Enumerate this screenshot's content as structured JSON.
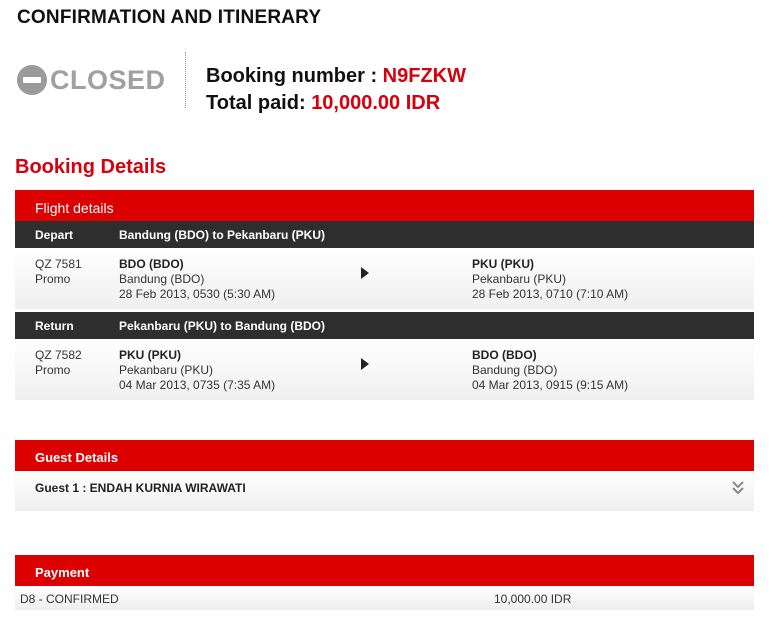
{
  "page": {
    "title": "CONFIRMATION AND ITINERARY"
  },
  "status": {
    "label": "CLOSED",
    "icon": "minus-circle-icon"
  },
  "summary": {
    "booking_label": "Booking number : ",
    "booking_number": "N9FZKW",
    "total_label": "Total paid: ",
    "total_value": "10,000.00 IDR"
  },
  "booking_details": {
    "heading": "Booking Details",
    "panel_title": "Flight details",
    "segments": [
      {
        "direction": "Depart",
        "route": "Bandung (BDO) to Pekanbaru (PKU)",
        "flight_no": "QZ 7581",
        "fare": "Promo",
        "from_code": "BDO (BDO)",
        "from_city": "Bandung (BDO)",
        "from_time": "28 Feb 2013, 0530 (5:30 AM)",
        "to_code": "PKU (PKU)",
        "to_city": "Pekanbaru (PKU)",
        "to_time": "28 Feb 2013, 0710 (7:10 AM)"
      },
      {
        "direction": "Return",
        "route": "Pekanbaru (PKU) to Bandung (BDO)",
        "flight_no": "QZ 7582",
        "fare": "Promo",
        "from_code": "PKU (PKU)",
        "from_city": "Pekanbaru (PKU)",
        "from_time": "04 Mar 2013, 0735 (7:35 AM)",
        "to_code": "BDO (BDO)",
        "to_city": "Bandung (BDO)",
        "to_time": "04 Mar 2013, 0915 (9:15 AM)"
      }
    ]
  },
  "guest_details": {
    "title": "Guest Details",
    "guests": [
      "Guest 1 : ENDAH KURNIA WIRAWATI"
    ],
    "expand_icon": "double-chevron-down-icon"
  },
  "payment": {
    "title": "Payment",
    "rows": [
      {
        "label": "D8 - CONFIRMED",
        "amount": "10,000.00 IDR"
      }
    ]
  },
  "colors": {
    "accent_red": "#dd0000",
    "dark_bar": "#2e2e2e",
    "status_gray": "#9a9a9a"
  }
}
